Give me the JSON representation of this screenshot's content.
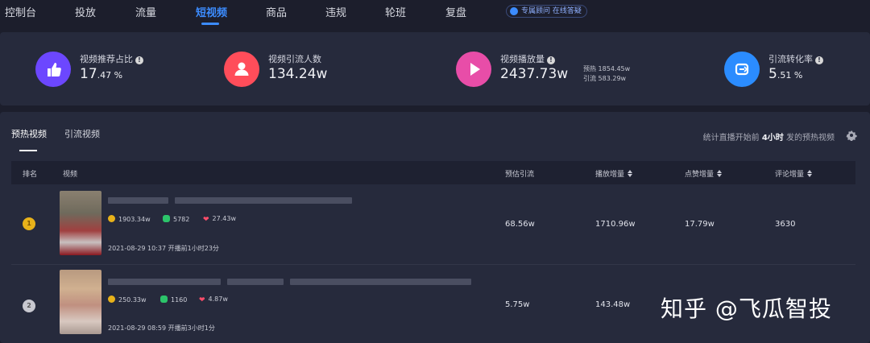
{
  "nav": {
    "items": [
      "控制台",
      "投放",
      "流量",
      "短视频",
      "商品",
      "违规",
      "轮班",
      "复盘"
    ],
    "active_index": 3,
    "consult_label": "专属顾问 在线答疑"
  },
  "stats": [
    {
      "label": "视频推荐占比",
      "value_main": "17",
      "value_small": ".47 %",
      "color": "#6c47ff",
      "icon": "thumbs-up-icon"
    },
    {
      "label": "视频引流人数",
      "value_main": "134.24w",
      "value_small": "",
      "color": "#ff4d5a",
      "icon": "user-icon"
    },
    {
      "label": "视频播放量",
      "value_main": "2437.73w",
      "value_small": "",
      "color": "#e84da8",
      "icon": "play-icon",
      "sub": {
        "warmup_label": "预热",
        "warmup_value": "1854.45w",
        "traffic_label": "引流",
        "traffic_value": "583.29w"
      }
    },
    {
      "label": "引流转化率",
      "value_main": "5",
      "value_small": ".51 %",
      "color": "#2b8cff",
      "icon": "convert-icon"
    }
  ],
  "tabs": [
    "预热视频",
    "引流视频"
  ],
  "note": {
    "prefix": "统计直播开始前 ",
    "highlight": "4小时",
    "suffix": " 发的预热视频"
  },
  "table": {
    "headers": [
      "排名",
      "视频",
      "预估引流",
      "播放增量",
      "点赞增量",
      "评论增量"
    ],
    "rows": [
      {
        "rank": "1",
        "views": "1903.34w",
        "comments": "5782",
        "likes": "27.43w",
        "date": "2021-08-29 10:37",
        "relative": "开播前1小时23分",
        "est": "68.56w",
        "play": "1710.96w",
        "like_inc": "17.79w",
        "comment_inc": "3630"
      },
      {
        "rank": "2",
        "views": "250.33w",
        "comments": "1160",
        "likes": "4.87w",
        "date": "2021-08-29 08:59",
        "relative": "开播前3小时1分",
        "est": "5.75w",
        "play": "143.48w",
        "like_inc": "",
        "comment_inc": ""
      }
    ]
  },
  "watermark": "知乎 @飞瓜智投"
}
